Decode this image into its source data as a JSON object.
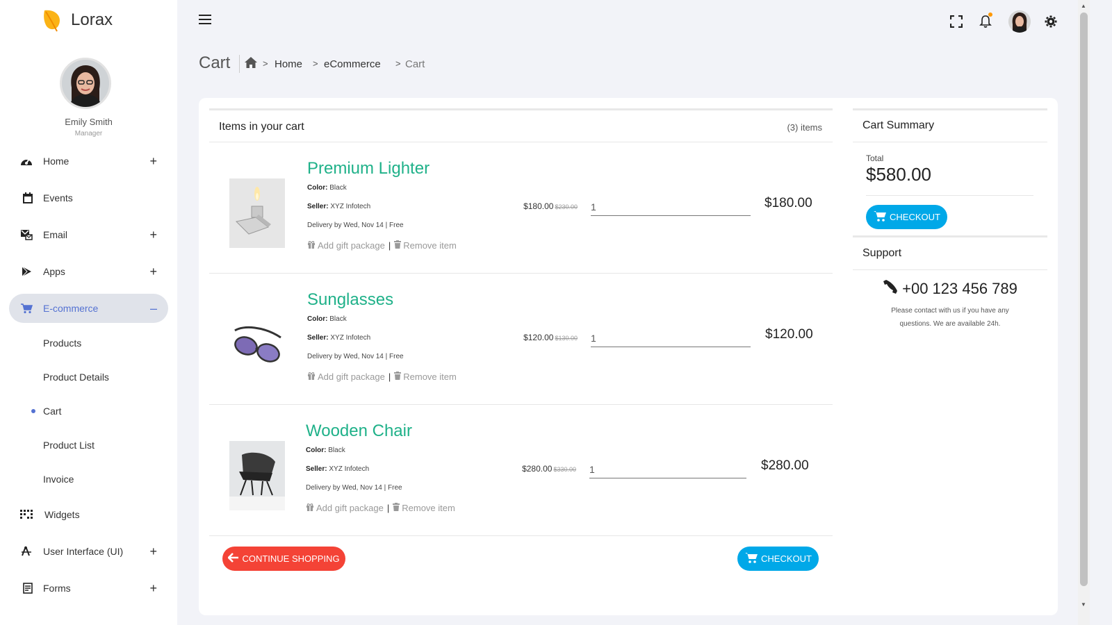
{
  "app": {
    "name": "Lorax"
  },
  "profile": {
    "name": "Emily Smith",
    "role": "Manager"
  },
  "nav": {
    "home": "Home",
    "events": "Events",
    "email": "Email",
    "apps": "Apps",
    "ecommerce": "E-commerce",
    "widgets": "Widgets",
    "ui": "User Interface (UI)",
    "forms": "Forms",
    "plus": "+",
    "minus": "–"
  },
  "ecommerce_sub": {
    "products": "Products",
    "product_details": "Product Details",
    "cart": "Cart",
    "product_list": "Product List",
    "invoice": "Invoice"
  },
  "page": {
    "title": "Cart",
    "breadcrumb": [
      "Home",
      "eCommerce",
      "Cart"
    ]
  },
  "cart": {
    "title": "Items in your cart",
    "count": "(3) items",
    "color_label": "Color:",
    "seller_label": "Seller:",
    "gift_link": "Add gift package",
    "remove_link": "Remove item",
    "separator": "|",
    "items": [
      {
        "name": "Premium Lighter",
        "color": "Black",
        "seller": "XYZ Infotech",
        "delivery": "Delivery by Wed, Nov 14 | Free",
        "price": "$180.00",
        "old_price": "$230.00",
        "qty": "1",
        "total": "$180.00"
      },
      {
        "name": "Sunglasses",
        "color": "Black",
        "seller": "XYZ Infotech",
        "delivery": "Delivery by Wed, Nov 14 | Free",
        "price": "$120.00",
        "old_price": "$130.00",
        "qty": "1",
        "total": "$120.00"
      },
      {
        "name": "Wooden Chair",
        "color": "Black",
        "seller": "XYZ Infotech",
        "delivery": "Delivery by Wed, Nov 14 | Free",
        "price": "$280.00",
        "old_price": "$330.00",
        "qty": "1",
        "total": "$280.00"
      }
    ],
    "continue_label": "Continue shopping",
    "checkout_label": "Checkout"
  },
  "summary": {
    "title": "Cart Summary",
    "total_label": "Total",
    "total_value": "$580.00",
    "checkout_label": "Checkout"
  },
  "support": {
    "title": "Support",
    "phone": "+00 123 456 789",
    "text": "Please contact with us if you have any questions. We are available 24h."
  },
  "colors": {
    "accent": "#5472d2",
    "product": "#1fb189",
    "checkout": "#00a8e8",
    "continue": "#f44336"
  },
  "icons": [
    "menu-icon",
    "fullscreen-icon",
    "bell-icon",
    "gear-icon",
    "home-icon",
    "cart-icon",
    "gift-icon",
    "trash-icon",
    "phone-icon",
    "arrow-left-icon"
  ]
}
